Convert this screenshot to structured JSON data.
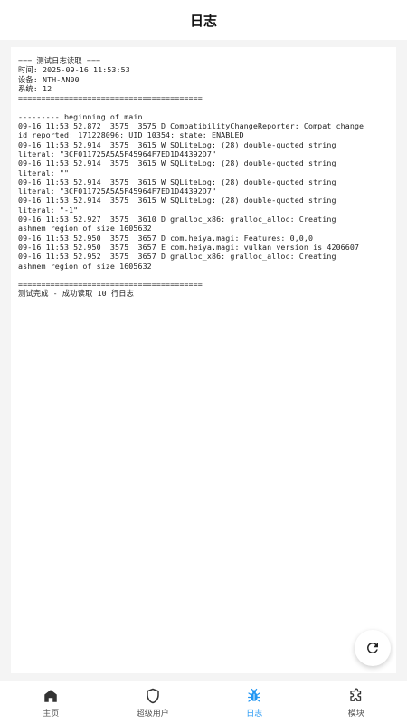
{
  "header": {
    "title": "日志"
  },
  "log": {
    "lines": [
      "=== 测试日志读取 ===",
      "时间: 2025-09-16 11:53:53",
      "设备: NTH-AN00",
      "系统: 12",
      "========================================",
      "",
      "--------- beginning of main",
      "09-16 11:53:52.872  3575  3575 D CompatibilityChangeReporter: Compat change",
      "id reported: 171228096; UID 10354; state: ENABLED",
      "09-16 11:53:52.914  3575  3615 W SQLiteLog: (28) double-quoted string",
      "literal: \"3CF011725A5A5F45964F7ED1D44392D7\"",
      "09-16 11:53:52.914  3575  3615 W SQLiteLog: (28) double-quoted string",
      "literal: \"\"",
      "09-16 11:53:52.914  3575  3615 W SQLiteLog: (28) double-quoted string",
      "literal: \"3CF011725A5A5F45964F7ED1D44392D7\"",
      "09-16 11:53:52.914  3575  3615 W SQLiteLog: (28) double-quoted string",
      "literal: \"-1\"",
      "09-16 11:53:52.927  3575  3610 D gralloc_x86: gralloc_alloc: Creating",
      "ashmem region of size 1605632",
      "09-16 11:53:52.950  3575  3657 D com.heiya.magi: Features: 0,0,0",
      "09-16 11:53:52.950  3575  3657 E com.heiya.magi: vulkan version is 4206607",
      "09-16 11:53:52.952  3575  3657 D gralloc_x86: gralloc_alloc: Creating",
      "ashmem region of size 1605632",
      "",
      "========================================",
      "测试完成 - 成功读取 10 行日志"
    ]
  },
  "fab": {
    "icon": "refresh-icon"
  },
  "tabs": [
    {
      "label": "主页",
      "icon": "home-icon",
      "active": false
    },
    {
      "label": "超级用户",
      "icon": "shield-icon",
      "active": false
    },
    {
      "label": "日志",
      "icon": "bug-icon",
      "active": true
    },
    {
      "label": "模块",
      "icon": "puzzle-icon",
      "active": false
    }
  ],
  "colors": {
    "accent": "#2196f3",
    "icon_default": "#333333"
  }
}
